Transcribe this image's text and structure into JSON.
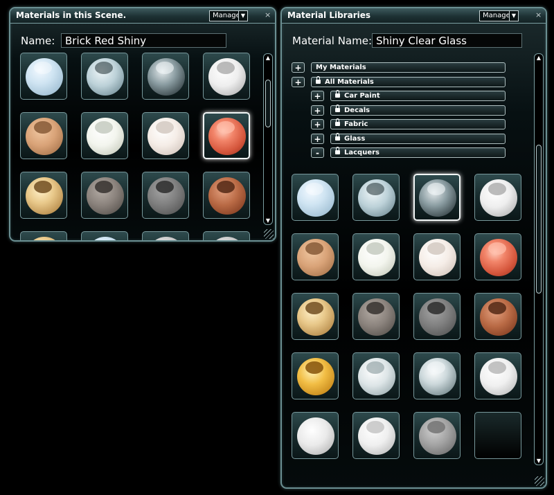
{
  "scene_panel": {
    "title": "Materials in this Scene.",
    "manage_label": "Manage",
    "dropdown_glyph": "▼",
    "close_glyph": "×",
    "name_label": "Name:",
    "name_value": "Brick Red Shiny",
    "scroll_up": "▲",
    "scroll_down": "▼",
    "materials": [
      {
        "swatch": "translucent-blue"
      },
      {
        "swatch": "clear-glass-open"
      },
      {
        "swatch": "clear-glass-dark"
      },
      {
        "swatch": "white-glossy"
      },
      {
        "swatch": "tan-matte"
      },
      {
        "swatch": "white-pearl"
      },
      {
        "swatch": "off-white"
      },
      {
        "swatch": "red-shiny",
        "selected": true
      },
      {
        "swatch": "gold-knurled"
      },
      {
        "swatch": "grey-brushed"
      },
      {
        "swatch": "dark-grey-brushed"
      },
      {
        "swatch": "copper-brown"
      },
      {
        "swatch": "gold-partial"
      },
      {
        "swatch": "blue-partial"
      },
      {
        "swatch": "grey-partial"
      },
      {
        "swatch": "grey-partial"
      }
    ]
  },
  "library_panel": {
    "title": "Material Libraries",
    "manage_label": "Manage",
    "dropdown_glyph": "▼",
    "close_glyph": "×",
    "name_label": "Material Name:",
    "name_value": "Shiny Clear Glass",
    "scroll_up": "▲",
    "scroll_down": "▼",
    "tree": [
      {
        "toggle": "+",
        "label": "My Materials",
        "locked": false,
        "indent": 0
      },
      {
        "toggle": "+",
        "label": "All Materials",
        "locked": true,
        "indent": 0
      },
      {
        "toggle": "+",
        "label": "Car Paint",
        "locked": true,
        "indent": 1
      },
      {
        "toggle": "+",
        "label": "Decals",
        "locked": true,
        "indent": 1
      },
      {
        "toggle": "+",
        "label": "Fabric",
        "locked": true,
        "indent": 1
      },
      {
        "toggle": "+",
        "label": "Glass",
        "locked": true,
        "indent": 1
      },
      {
        "toggle": "-",
        "label": "Lacquers",
        "locked": true,
        "indent": 1
      }
    ],
    "materials": [
      {
        "swatch": "translucent-blue"
      },
      {
        "swatch": "clear-glass-open"
      },
      {
        "swatch": "clear-glass-dark",
        "selected": true
      },
      {
        "swatch": "white-glossy"
      },
      {
        "swatch": "tan-matte"
      },
      {
        "swatch": "white-pearl"
      },
      {
        "swatch": "off-white"
      },
      {
        "swatch": "red-shiny"
      },
      {
        "swatch": "gold-knurled"
      },
      {
        "swatch": "grey-brushed"
      },
      {
        "swatch": "dark-grey-brushed"
      },
      {
        "swatch": "copper-brown"
      },
      {
        "swatch": "gold-glossy"
      },
      {
        "swatch": "frosted-glass"
      },
      {
        "swatch": "clear-glass-cone"
      },
      {
        "swatch": "white-frost"
      },
      {
        "swatch": "white-cracked"
      },
      {
        "swatch": "white-satin"
      },
      {
        "swatch": "grey-satin"
      },
      {
        "swatch": "empty"
      }
    ]
  }
}
